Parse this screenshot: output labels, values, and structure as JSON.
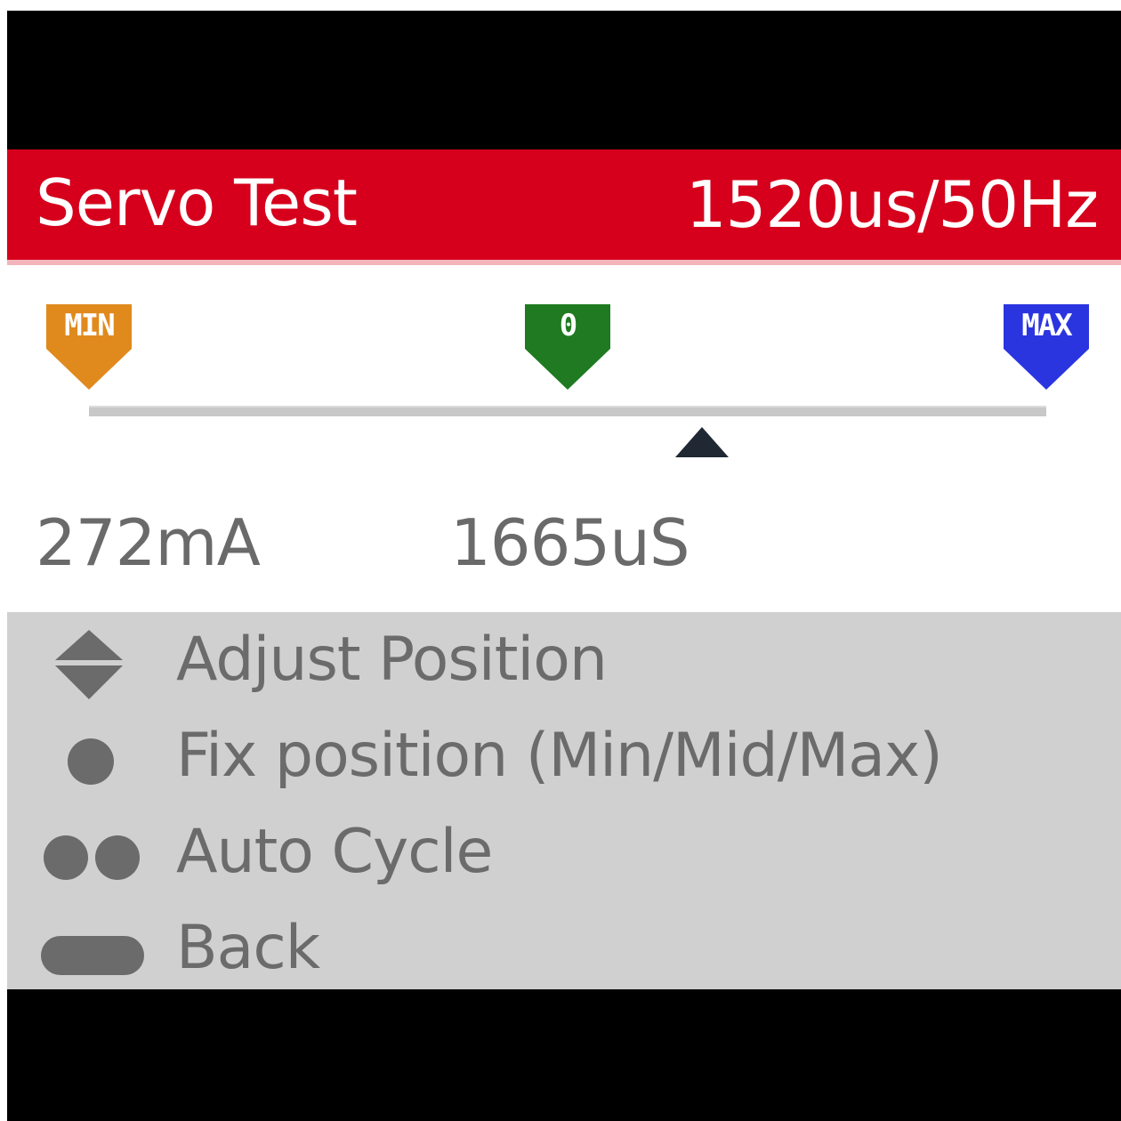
{
  "header": {
    "title": "Servo Test",
    "pulse_rate": "1520us/50Hz",
    "color": "#d6001c"
  },
  "markers": {
    "min": {
      "label": "MIN",
      "color": "#e08a1e",
      "icon": "min-marker-icon"
    },
    "center": {
      "label": "0",
      "color": "#1f7a22",
      "icon": "center-marker-icon"
    },
    "max": {
      "label": "MAX",
      "color": "#2a35e0",
      "icon": "max-marker-icon"
    }
  },
  "position": {
    "fraction": 0.64
  },
  "readouts": {
    "current": "272mA",
    "pulse_width": "1665uS"
  },
  "menu": {
    "items": [
      {
        "icon": "up-down-arrows-icon",
        "label": "Adjust Position"
      },
      {
        "icon": "single-dot-icon",
        "label": "Fix position (Min/Mid/Max)"
      },
      {
        "icon": "double-dot-icon",
        "label": "Auto Cycle"
      },
      {
        "icon": "long-press-bar-icon",
        "label": "Back"
      }
    ]
  }
}
